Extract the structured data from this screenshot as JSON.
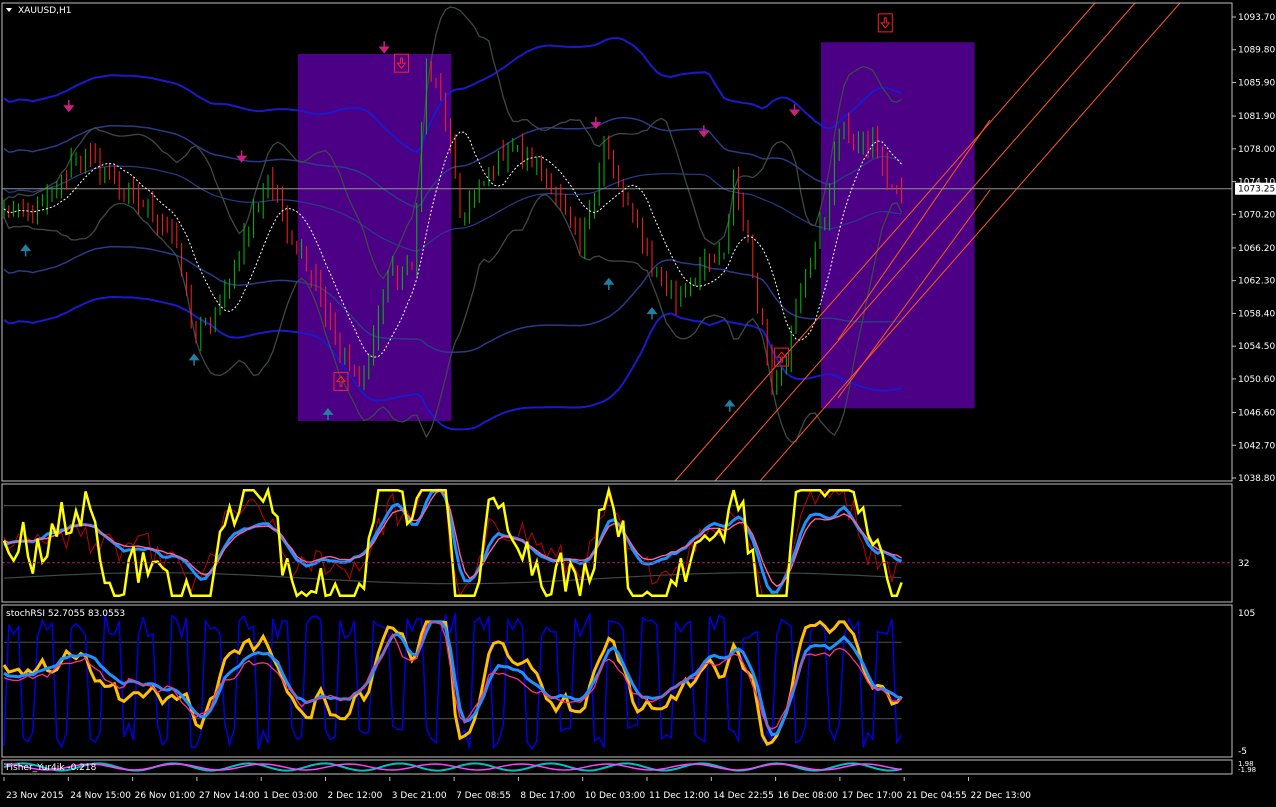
{
  "window": {
    "symbol_title": "XAUUSD,H1"
  },
  "colors": {
    "background": "#000000",
    "frame": "#c0c0c0",
    "up_candle": "#00c000",
    "down_candle": "#ff2020",
    "band_outer": "#1a1acc",
    "band_inner": "#2a3a8a",
    "envelope": "#3a4a48",
    "box": "#4b0085",
    "channel": "#ff5a1e",
    "arrow_up": "#cc2080",
    "arrow_teal": "#2080a0",
    "yellow": "#ffff00",
    "stoch_yellow": "#ffc000",
    "blue_line": "#0000e0",
    "cyan": "#1e90ff"
  },
  "chart_data": [
    {
      "type": "candlestick",
      "title": "XAUUSD,H1",
      "ylim": [
        1038.8,
        1095.3
      ],
      "y_ticks": [
        "1093.70",
        "1089.80",
        "1085.90",
        "1081.90",
        "1078.00",
        "1074.10",
        "1070.20",
        "1066.20",
        "1062.30",
        "1058.40",
        "1054.50",
        "1050.60",
        "1046.60",
        "1042.70",
        "1038.80"
      ],
      "current_price": "1073.25",
      "x_tick_labels": [
        "23 Nov 2015",
        "24 Nov 15:00",
        "26 Nov 01:00",
        "27 Nov 14:00",
        "1 Dec 03:00",
        "2 Dec 12:00",
        "3 Dec 21:00",
        "7 Dec 08:55",
        "8 Dec 17:00",
        "10 Dec 03:00",
        "11 Dec 12:00",
        "14 Dec 22:55",
        "16 Dec 08:00",
        "17 Dec 17:00",
        "21 Dec 04:55",
        "22 Dec 13:00"
      ],
      "close_path": [
        [
          0,
          1070.5
        ],
        [
          5,
          1070
        ],
        [
          10,
          1072
        ],
        [
          15,
          1077.5
        ],
        [
          20,
          1076
        ],
        [
          25,
          1073
        ],
        [
          30,
          1071
        ],
        [
          35,
          1068
        ],
        [
          40,
          1055.5
        ],
        [
          45,
          1059
        ],
        [
          50,
          1067.5
        ],
        [
          55,
          1074.5
        ],
        [
          60,
          1067.5
        ],
        [
          65,
          1062.5
        ],
        [
          70,
          1053
        ],
        [
          75,
          1050.5
        ],
        [
          80,
          1063
        ],
        [
          85,
          1063.5
        ],
        [
          88,
          1088
        ],
        [
          92,
          1082
        ],
        [
          95,
          1070
        ],
        [
          100,
          1074
        ],
        [
          105,
          1078.5
        ],
        [
          110,
          1076.5
        ],
        [
          115,
          1073
        ],
        [
          120,
          1066
        ],
        [
          125,
          1078
        ],
        [
          130,
          1071
        ],
        [
          135,
          1064
        ],
        [
          140,
          1060
        ],
        [
          145,
          1063.5
        ],
        [
          150,
          1065
        ],
        [
          152,
          1075
        ],
        [
          155,
          1066
        ],
        [
          160,
          1051
        ],
        [
          163,
          1053.5
        ],
        [
          167,
          1063
        ],
        [
          171,
          1070
        ],
        [
          174,
          1080.5
        ],
        [
          178,
          1078.5
        ],
        [
          181,
          1079
        ],
        [
          184,
          1074
        ],
        [
          187,
          1072
        ]
      ],
      "arrows_up": [
        [
          5,
          1066.5
        ],
        [
          44,
          1053.5
        ],
        [
          75,
          1047
        ],
        [
          140,
          1062.5
        ],
        [
          150,
          1059
        ],
        [
          168,
          1048
        ]
      ],
      "arrows_down": [
        [
          15,
          1082.5
        ],
        [
          55,
          1076.5
        ],
        [
          88,
          1089.5
        ],
        [
          137,
          1080.5
        ],
        [
          162,
          1079.5
        ],
        [
          183,
          1082
        ]
      ],
      "signal_boxes": [
        {
          "x0": 61,
          "x1": 93,
          "y_top": 1089.3,
          "y_bot": 1045.6
        },
        {
          "x0": 170,
          "x1": 202,
          "y_top": 1090.7,
          "y_bot": 1047.1
        }
      ],
      "box_icons": [
        {
          "x": 92,
          "y": 1088.2,
          "dir": "down"
        },
        {
          "x": 78,
          "y": 1050.3,
          "dir": "up"
        },
        {
          "x": 180,
          "y": 1053.2,
          "dir": "up"
        },
        {
          "x": 204,
          "y": 1093.0,
          "dir": "down"
        }
      ]
    },
    {
      "type": "line",
      "title": "",
      "ylim": [
        0,
        100
      ],
      "level_label": "32",
      "level": 32,
      "series": []
    },
    {
      "type": "line",
      "title": "stochRSI 52.7055 83.0553",
      "ylim": [
        -5,
        105
      ],
      "y_ticks": [
        "105",
        "-5"
      ],
      "series": []
    },
    {
      "type": "line",
      "title": "Fisher_Yur4ik -0.218",
      "y_ticks": [
        "1.98",
        "-1.98"
      ],
      "series": []
    }
  ]
}
